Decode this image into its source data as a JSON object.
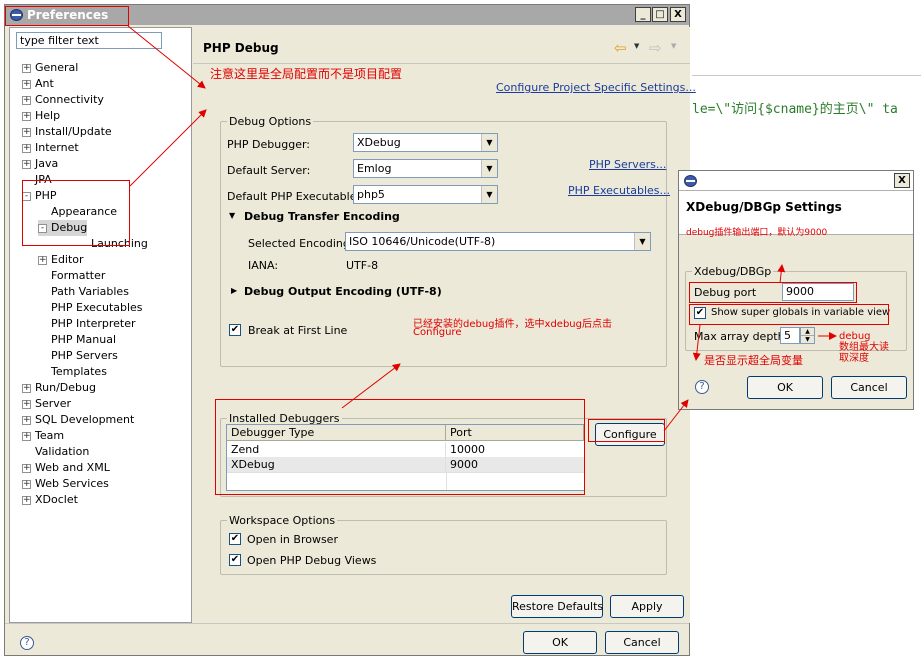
{
  "window": {
    "title": "Preferences",
    "minimize": "_",
    "maximize": "□",
    "close": "X"
  },
  "filter": {
    "value": "type filter text"
  },
  "tree": [
    {
      "label": "General",
      "expander": "+"
    },
    {
      "label": "Ant",
      "expander": "+"
    },
    {
      "label": "Connectivity",
      "expander": "+"
    },
    {
      "label": "Help",
      "expander": "+"
    },
    {
      "label": "Install/Update",
      "expander": "+"
    },
    {
      "label": "Internet",
      "expander": "+"
    },
    {
      "label": "Java",
      "expander": "+"
    },
    {
      "label": "JPA",
      "expander": ""
    },
    {
      "label": "PHP",
      "expander": "-"
    },
    {
      "label": "Appearance",
      "expander": ""
    },
    {
      "label": "Debug",
      "expander": "-"
    },
    {
      "label": "Launching",
      "expander": ""
    },
    {
      "label": "Editor",
      "expander": "+"
    },
    {
      "label": "Formatter",
      "expander": ""
    },
    {
      "label": "Path Variables",
      "expander": ""
    },
    {
      "label": "PHP Executables",
      "expander": ""
    },
    {
      "label": "PHP Interpreter",
      "expander": ""
    },
    {
      "label": "PHP Manual",
      "expander": ""
    },
    {
      "label": "PHP Servers",
      "expander": ""
    },
    {
      "label": "Templates",
      "expander": ""
    },
    {
      "label": "Run/Debug",
      "expander": "+"
    },
    {
      "label": "Server",
      "expander": "+"
    },
    {
      "label": "SQL Development",
      "expander": "+"
    },
    {
      "label": "Team",
      "expander": "+"
    },
    {
      "label": "Validation",
      "expander": ""
    },
    {
      "label": "Web and XML",
      "expander": "+"
    },
    {
      "label": "Web Services",
      "expander": "+"
    },
    {
      "label": "XDoclet",
      "expander": "+"
    }
  ],
  "page": {
    "title": "PHP Debug",
    "project_link": "Configure Project Specific Settings...",
    "debug_options": {
      "group_label": "Debug Options",
      "debugger_label": "PHP Debugger:",
      "debugger_value": "XDebug",
      "server_label": "Default Server:",
      "server_value": "Emlog",
      "servers_link": "PHP Servers...",
      "executable_label": "Default PHP Executable:",
      "executable_value": "php5",
      "executables_link": "PHP Executables...",
      "transfer_section": "Debug Transfer Encoding",
      "encoding_label": "Selected Encoding:",
      "encoding_value": "ISO 10646/Unicode(UTF-8)",
      "iana_label": "IANA:",
      "iana_value": "UTF-8",
      "output_section": "Debug Output Encoding (UTF-8)",
      "break_label": "Break at First Line"
    },
    "installed": {
      "group_label": "Installed Debuggers",
      "columns": [
        "Debugger Type",
        "Port"
      ],
      "rows": [
        [
          "Zend",
          "10000"
        ],
        [
          "XDebug",
          "9000"
        ]
      ],
      "configure_button": "Configure"
    },
    "workspace": {
      "group_label": "Workspace Options",
      "open_browser": "Open in Browser",
      "open_views": "Open PHP Debug Views"
    },
    "restore_button": "Restore Defaults",
    "apply_button": "Apply",
    "ok_button": "OK",
    "cancel_button": "Cancel"
  },
  "annotations": {
    "global_note": "注意这里是全局配置而不是项目配置",
    "installed_note_1": "已经安装的debug插件，选中xdebug后点击",
    "installed_note_2": "Configure",
    "port_note": "debug插件输出端口，默认为9000",
    "globals_note": "是否显示超全局变量",
    "depth_note_1": "debug",
    "depth_note_2": "数组最大读",
    "depth_note_3": "取深度"
  },
  "background_code": "le=\\\"访问{$cname}的主页\\\" ta",
  "xdebug_dialog": {
    "close": "X",
    "title": "XDebug/DBGp Settings",
    "group_label": "Xdebug/DBGp",
    "port_label": "Debug port",
    "port_value": "9000",
    "globals_label": "Show super globals in variable view",
    "depth_label": "Max array depth",
    "depth_value": "5",
    "ok_button": "OK",
    "cancel_button": "Cancel"
  },
  "icons": {
    "help": "?",
    "check": "✔",
    "back": "⇦",
    "forward": "⇨",
    "dropdown": "▼",
    "expanded": "▼",
    "collapsed": "▶"
  }
}
